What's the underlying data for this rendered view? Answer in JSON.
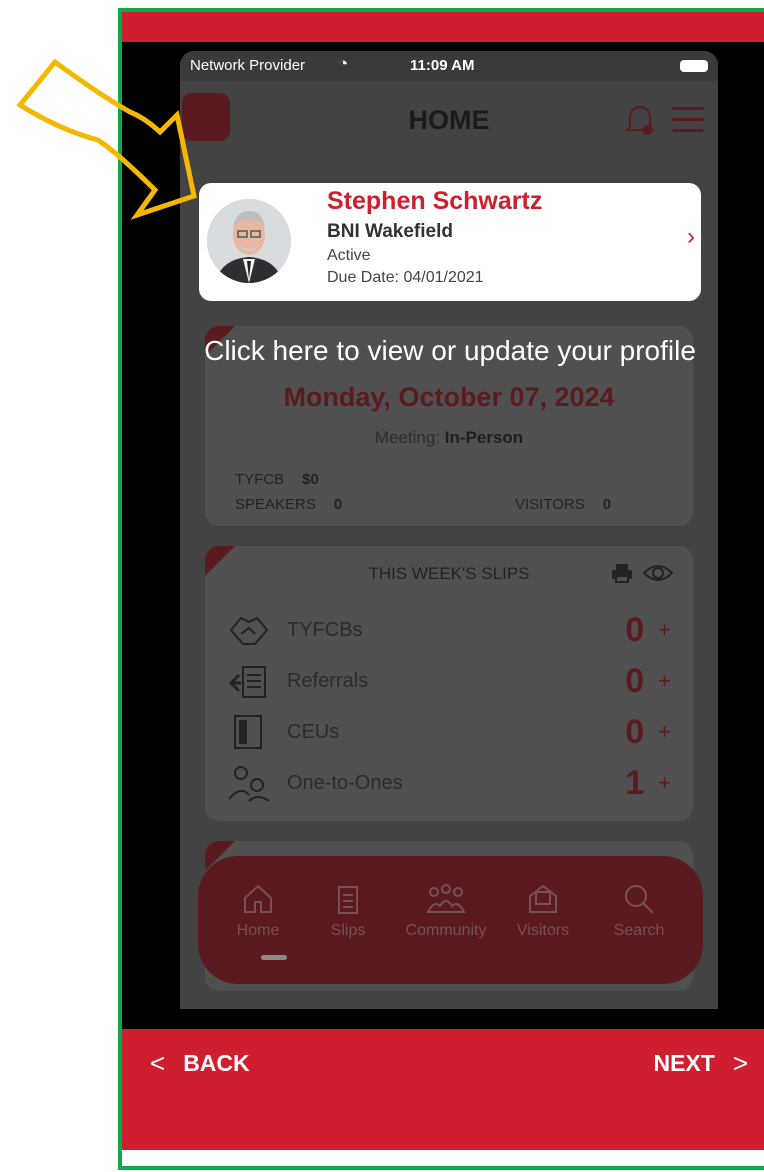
{
  "status_bar": {
    "provider": "Network Provider",
    "time": "11:09 AM"
  },
  "header": {
    "title": "HOME"
  },
  "profile": {
    "name": "Stephen Schwartz",
    "chapter": "BNI Wakefield",
    "status": "Active",
    "due_date": "Due Date: 04/01/2021"
  },
  "tooltip": {
    "text": "Click here to view or update your profile"
  },
  "meeting": {
    "date": "Monday, October 07, 2024",
    "type_label": "Meeting:",
    "type_value": "In-Person",
    "tyfcb_label": "TYFCB",
    "tyfcb_value": "$0",
    "speakers_label": "SPEAKERS",
    "speakers_value": "0",
    "visitors_label": "VISITORS",
    "visitors_value": "0"
  },
  "slips": {
    "title": "THIS WEEK'S SLIPS",
    "rows": [
      {
        "label": "TYFCBs",
        "count": "0",
        "plus": "+"
      },
      {
        "label": "Referrals",
        "count": "0",
        "plus": "+"
      },
      {
        "label": "CEUs",
        "count": "0",
        "plus": "+"
      },
      {
        "label": "One-to-Ones",
        "count": "1",
        "plus": "+"
      }
    ]
  },
  "tabs": [
    {
      "label": "Home",
      "icon": "home-icon"
    },
    {
      "label": "Slips",
      "icon": "slips-icon"
    },
    {
      "label": "Community",
      "icon": "community-icon"
    },
    {
      "label": "Visitors",
      "icon": "visitors-icon"
    },
    {
      "label": "Search",
      "icon": "search-icon"
    }
  ],
  "walkthrough": {
    "back": "BACK",
    "next": "NEXT"
  },
  "colors": {
    "brand_red": "#cf1f2e",
    "frame_green": "#0fa84a",
    "highlight_arrow": "#f5b800"
  }
}
